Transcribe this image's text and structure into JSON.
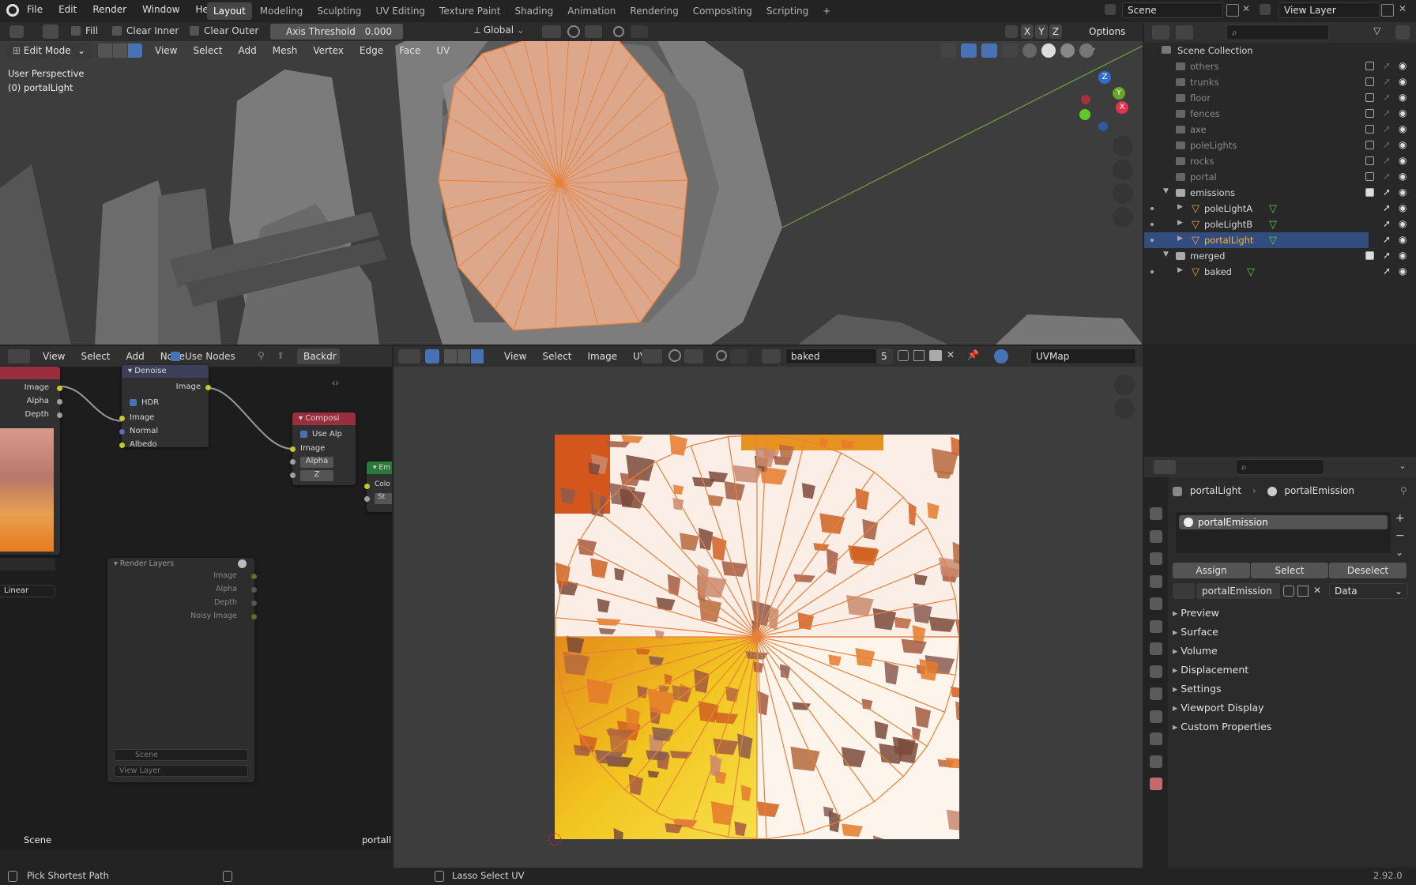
{
  "app": {
    "version": "2.92.0"
  },
  "topbar": {
    "menus": [
      "File",
      "Edit",
      "Render",
      "Window",
      "Help"
    ],
    "workspaces": [
      "Layout",
      "Modeling",
      "Sculpting",
      "UV Editing",
      "Texture Paint",
      "Shading",
      "Animation",
      "Rendering",
      "Compositing",
      "Scripting"
    ],
    "active_workspace": "Layout",
    "scene": "Scene",
    "view_layer": "View Layer"
  },
  "tool_header": {
    "fill": "Fill",
    "clear_inner": "Clear Inner",
    "clear_outer": "Clear Outer",
    "axis_threshold_label": "Axis Threshold",
    "axis_threshold_value": "0.000",
    "orientation": "Global",
    "options": "Options",
    "axes": [
      "X",
      "Y",
      "Z"
    ]
  },
  "viewport": {
    "mode": "Edit Mode",
    "menus": [
      "View",
      "Select",
      "Add",
      "Mesh",
      "Vertex",
      "Edge",
      "Face",
      "UV"
    ],
    "info_line1": "User Perspective",
    "info_line2": "(0) portalLight",
    "gizmo_labels": [
      "Z",
      "Y",
      "X"
    ]
  },
  "outliner": {
    "root": "Scene Collection",
    "items": [
      {
        "label": "others",
        "level": 1,
        "disabled": true
      },
      {
        "label": "trunks",
        "level": 1,
        "disabled": true
      },
      {
        "label": "floor",
        "level": 1,
        "disabled": true
      },
      {
        "label": "fences",
        "level": 1,
        "disabled": true
      },
      {
        "label": "axe",
        "level": 1,
        "disabled": true
      },
      {
        "label": "poleLights",
        "level": 1,
        "disabled": true
      },
      {
        "label": "rocks",
        "level": 1,
        "disabled": true
      },
      {
        "label": "portal",
        "level": 1,
        "disabled": true
      },
      {
        "label": "emissions",
        "level": 1,
        "disabled": false
      },
      {
        "label": "poleLightA",
        "level": 2,
        "disabled": false
      },
      {
        "label": "poleLightB",
        "level": 2,
        "disabled": false
      },
      {
        "label": "portalLight",
        "level": 2,
        "disabled": false,
        "selected": true
      },
      {
        "label": "merged",
        "level": 1,
        "disabled": false
      },
      {
        "label": "baked",
        "level": 2,
        "disabled": false
      }
    ]
  },
  "node_editor": {
    "menus": [
      "View",
      "Select",
      "Add",
      "Node"
    ],
    "use_nodes": "Use Nodes",
    "backdrop": "Backdr",
    "denoise": {
      "title": "Denoise",
      "out_image": "Image",
      "hdr": "HDR",
      "in_image": "Image",
      "in_normal": "Normal",
      "in_albedo": "Albedo"
    },
    "left_node_sockets": [
      "Image",
      "Alpha",
      "Depth"
    ],
    "composite": {
      "title": "Composi",
      "use_alpha": "Use Alp",
      "image": "Image",
      "alpha": "Alpha",
      "z": "Z"
    },
    "emission_partial": {
      "title": "Em",
      "color": "Colo",
      "strength": "St"
    },
    "render_layers": {
      "title": "Render Layers",
      "outputs": [
        "Image",
        "Alpha",
        "Depth",
        "Noisy Image"
      ],
      "scene": "Scene",
      "view_layer": "View Layer"
    },
    "image_node_interp": "Linear",
    "footer_left": "Scene",
    "footer_right": "portall"
  },
  "uv_editor": {
    "menus": [
      "View",
      "Select",
      "Image",
      "UV"
    ],
    "image_name": "baked",
    "users": "5",
    "uv_map": "UVMap"
  },
  "properties": {
    "breadcrumb_object": "portalLight",
    "breadcrumb_material": "portalEmission",
    "slot_name": "portalEmission",
    "assign": "Assign",
    "select": "Select",
    "deselect": "Deselect",
    "material_name": "portalEmission",
    "link": "Data",
    "panels": [
      "Preview",
      "Surface",
      "Volume",
      "Displacement",
      "Settings",
      "Viewport Display",
      "Custom Properties"
    ]
  },
  "statusbar": {
    "left": "Pick Shortest Path",
    "middle": "Lasso Select UV",
    "version": "2.92.0"
  },
  "colors": {
    "accent": "#4772b3",
    "selection": "#e8803a",
    "bg": "#232323",
    "panel": "#303030"
  }
}
